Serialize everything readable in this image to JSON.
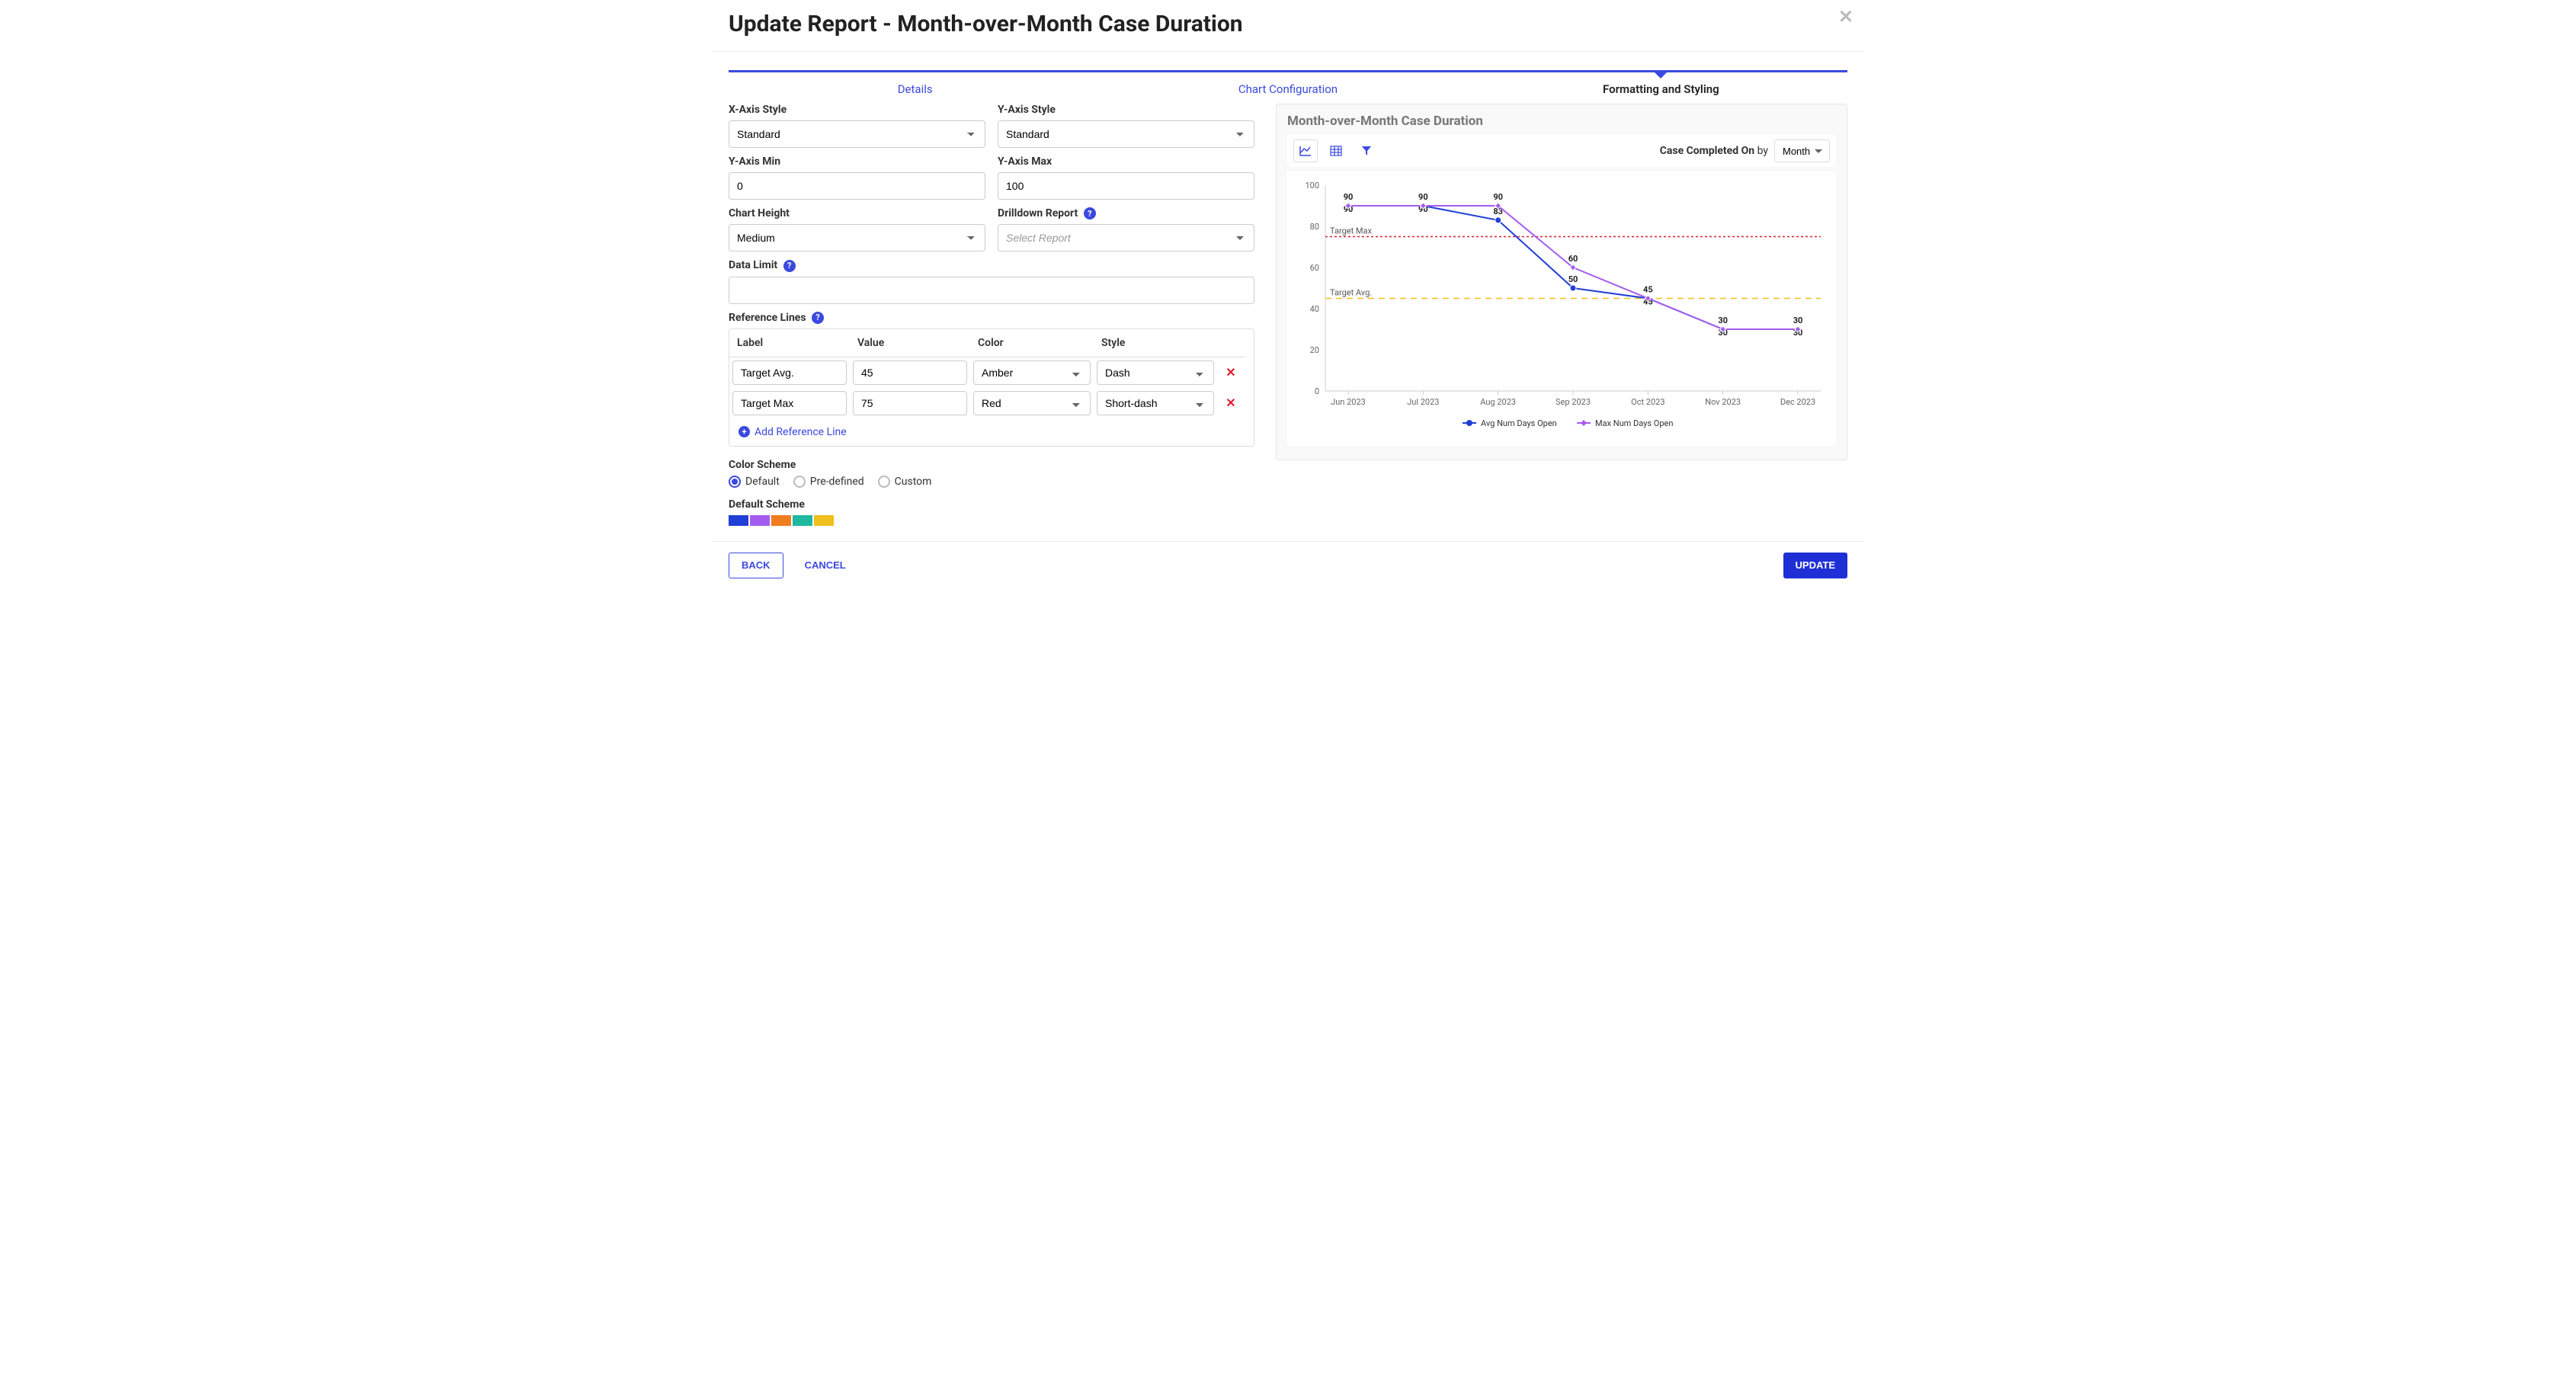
{
  "header": {
    "title": "Update Report - Month-over-Month Case Duration"
  },
  "stepper": {
    "steps": [
      "Details",
      "Chart Configuration",
      "Formatting and Styling"
    ]
  },
  "form": {
    "xaxis_style_label": "X-Axis Style",
    "xaxis_style_value": "Standard",
    "yaxis_style_label": "Y-Axis Style",
    "yaxis_style_value": "Standard",
    "yaxis_min_label": "Y-Axis Min",
    "yaxis_min_value": "0",
    "yaxis_max_label": "Y-Axis Max",
    "yaxis_max_value": "100",
    "chart_height_label": "Chart Height",
    "chart_height_value": "Medium",
    "drilldown_label": "Drilldown Report",
    "drilldown_placeholder": "Select Report",
    "data_limit_label": "Data Limit",
    "reference_lines_label": "Reference Lines",
    "ref_headers": {
      "label": "Label",
      "value": "Value",
      "color": "Color",
      "style": "Style"
    },
    "ref_rows": [
      {
        "label": "Target Avg.",
        "value": "45",
        "color": "Amber",
        "style": "Dash"
      },
      {
        "label": "Target Max",
        "value": "75",
        "color": "Red",
        "style": "Short-dash"
      }
    ],
    "add_reference_line": "Add Reference Line",
    "color_scheme_label": "Color Scheme",
    "color_scheme_options": [
      "Default",
      "Pre-defined",
      "Custom"
    ],
    "color_scheme_selected": "Default",
    "default_scheme_label": "Default Scheme",
    "default_scheme_colors": [
      "#1f3fd6",
      "#a45cf0",
      "#f07c1f",
      "#1fb8a0",
      "#f0c01f"
    ]
  },
  "preview": {
    "title": "Month-over-Month Case Duration",
    "by_strong": "Case Completed On",
    "by_word": "by",
    "by_value": "Month"
  },
  "chart_data": {
    "type": "line",
    "title": "Month-over-Month Case Duration",
    "xlabel": "",
    "ylabel": "",
    "ylim": [
      0,
      100
    ],
    "y_ticks": [
      0,
      20,
      40,
      60,
      80,
      100
    ],
    "categories": [
      "Jun 2023",
      "Jul 2023",
      "Aug 2023",
      "Sep 2023",
      "Oct 2023",
      "Nov 2023",
      "Dec 2023"
    ],
    "series": [
      {
        "name": "Avg Num Days Open",
        "color": "#1f3fd6",
        "values": [
          90,
          90,
          83,
          50,
          45,
          30,
          30
        ]
      },
      {
        "name": "Max Num Days Open",
        "color": "#a45cf0",
        "values": [
          90,
          90,
          90,
          60,
          45,
          30,
          30
        ]
      }
    ],
    "reference_lines": [
      {
        "label": "Target Avg.",
        "value": 45,
        "color": "#f0c01f",
        "dash": "8,6"
      },
      {
        "label": "Target Max",
        "value": 75,
        "color": "#e01e2f",
        "dash": "3,3"
      }
    ],
    "legend_position": "bottom"
  },
  "footer": {
    "back": "BACK",
    "cancel": "CANCEL",
    "update": "UPDATE"
  }
}
